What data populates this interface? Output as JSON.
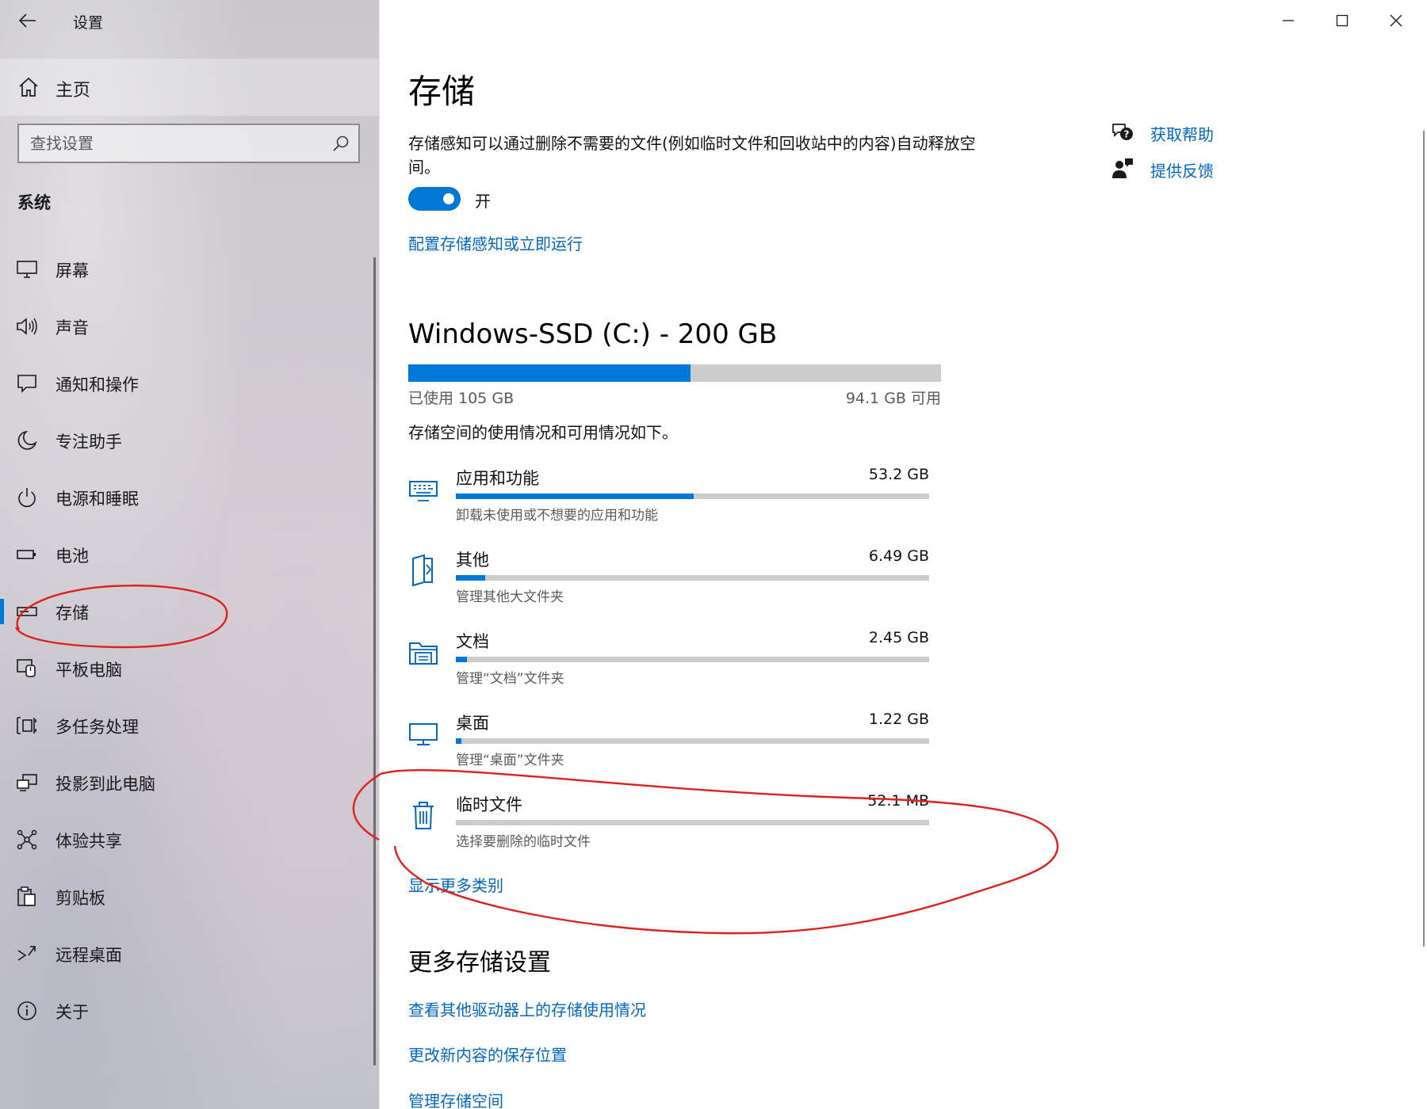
{
  "app": {
    "title": "设置"
  },
  "sidebar": {
    "home_label": "主页",
    "search_placeholder": "查找设置",
    "section": "系统",
    "items": [
      {
        "label": "屏幕",
        "icon": "monitor-icon"
      },
      {
        "label": "声音",
        "icon": "speaker-icon"
      },
      {
        "label": "通知和操作",
        "icon": "notification-icon"
      },
      {
        "label": "专注助手",
        "icon": "moon-icon"
      },
      {
        "label": "电源和睡眠",
        "icon": "power-icon"
      },
      {
        "label": "电池",
        "icon": "battery-icon"
      },
      {
        "label": "存储",
        "icon": "storage-icon",
        "active": true
      },
      {
        "label": "平板电脑",
        "icon": "tablet-icon"
      },
      {
        "label": "多任务处理",
        "icon": "multitask-icon"
      },
      {
        "label": "投影到此电脑",
        "icon": "project-icon"
      },
      {
        "label": "体验共享",
        "icon": "share-icon"
      },
      {
        "label": "剪贴板",
        "icon": "clipboard-icon"
      },
      {
        "label": "远程桌面",
        "icon": "remote-desktop-icon"
      },
      {
        "label": "关于",
        "icon": "info-icon"
      }
    ]
  },
  "main": {
    "title": "存储",
    "intro": "存储感知可以通过删除不需要的文件(例如临时文件和回收站中的内容)自动释放空间。",
    "toggle": {
      "state": "开",
      "on": true
    },
    "config_link": "配置存储感知或立即运行",
    "help": {
      "get_help": "获取帮助",
      "feedback": "提供反馈"
    },
    "drive": {
      "name": "Windows-SSD (C:) - 200 GB",
      "used_label": "已使用 105 GB",
      "free_label": "94.1 GB 可用",
      "used_fraction": 0.53
    },
    "usage_desc": "存储空间的使用情况和可用情况如下。",
    "categories": [
      {
        "name": "应用和功能",
        "size": "53.2 GB",
        "desc": "卸载未使用或不想要的应用和功能",
        "fraction": 0.503,
        "icon": "keyboard-icon"
      },
      {
        "name": "其他",
        "size": "6.49 GB",
        "desc": "管理其他大文件夹",
        "fraction": 0.062,
        "icon": "folder-other-icon"
      },
      {
        "name": "文档",
        "size": "2.45 GB",
        "desc": "管理“文档”文件夹",
        "fraction": 0.024,
        "icon": "documents-icon"
      },
      {
        "name": "桌面",
        "size": "1.22 GB",
        "desc": "管理“桌面”文件夹",
        "fraction": 0.012,
        "icon": "desktop-icon"
      },
      {
        "name": "临时文件",
        "size": "52.1 MB",
        "desc": "选择要删除的临时文件",
        "fraction": 0.0,
        "icon": "trash-icon"
      }
    ],
    "more_categories": "显示更多类别",
    "more_title": "更多存储设置",
    "more_links": [
      "查看其他驱动器上的存储使用情况",
      "更改新内容的保存位置",
      "管理存储空间"
    ]
  },
  "colors": {
    "accent": "#0078d7",
    "link": "#0067c0",
    "bar_track": "#cccccc",
    "annotation": "#e0201c"
  }
}
